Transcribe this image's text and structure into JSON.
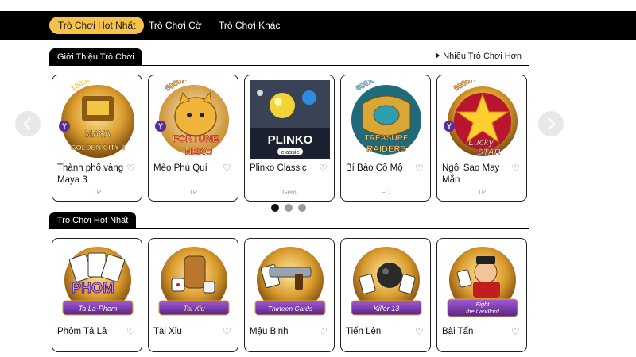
{
  "topnav": {
    "tabs": [
      {
        "label": "Trò Chơi Hot Nhất",
        "active": true
      },
      {
        "label": "Trò Chơi Cờ",
        "active": false
      },
      {
        "label": "Trò Chơi Khác",
        "active": false
      }
    ]
  },
  "featured": {
    "title": "Giới Thiệu Trò Chơi",
    "more_link": "Nhiều Trò Chơi Hơn",
    "cards": [
      {
        "name": "Thành phố vàng Maya 3",
        "provider": "TP",
        "art_text": "MAYA GOLDEN CITY 3",
        "badge": "1000X"
      },
      {
        "name": "Mèo Phú Quí",
        "provider": "TP",
        "art_text": "FORTUNE NEKO",
        "badge": "5000X"
      },
      {
        "name": "Plinko Classic",
        "provider": "Gem",
        "art_text": "PLINKO",
        "art_sub": "classic"
      },
      {
        "name": "Bí Bảo Cổ Mộ",
        "provider": "FC",
        "art_text": "TREASURE RAIDERS",
        "badge": "600X"
      },
      {
        "name": "Ngôi Sao May Mắn",
        "provider": "TP",
        "art_text": "Lucky STAR",
        "badge": "5000X"
      }
    ],
    "pagination": {
      "pages": 3,
      "current": 1
    }
  },
  "hot": {
    "title": "Trò Chơi Hot Nhất",
    "cards": [
      {
        "name": "Phỏm Tá Lả",
        "art_text": "Ta La-Phom"
      },
      {
        "name": "Tài Xỉu",
        "art_text": "Tai Xiu"
      },
      {
        "name": "Mậu Binh",
        "art_text": "Thirteen Cards"
      },
      {
        "name": "Tiến Lên",
        "art_text": "Killer 13"
      },
      {
        "name": "Bài Tấn",
        "art_text": "Fight the Landlord"
      }
    ]
  },
  "colors": {
    "accent": "#f6c24a",
    "topbar": "#000000",
    "card_border": "#1f1f1f",
    "dot_active": "#111111",
    "dot_inactive": "#9a9a9a"
  }
}
